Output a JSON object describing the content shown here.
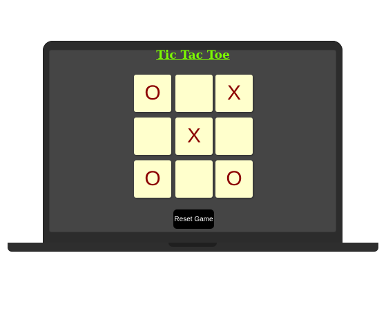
{
  "game": {
    "title": "Tic Tac Toe",
    "board": [
      [
        "O",
        "",
        "X"
      ],
      [
        "",
        "X",
        ""
      ],
      [
        "O",
        "",
        "O"
      ]
    ],
    "reset_label": "Reset Game"
  },
  "colors": {
    "title": "#7cfc00",
    "cell_bg": "#ffffcc",
    "mark": "#8b0000",
    "screen": "#454545",
    "bezel": "#2c2c2c",
    "button_bg": "#000000",
    "button_text": "#ffffff"
  }
}
